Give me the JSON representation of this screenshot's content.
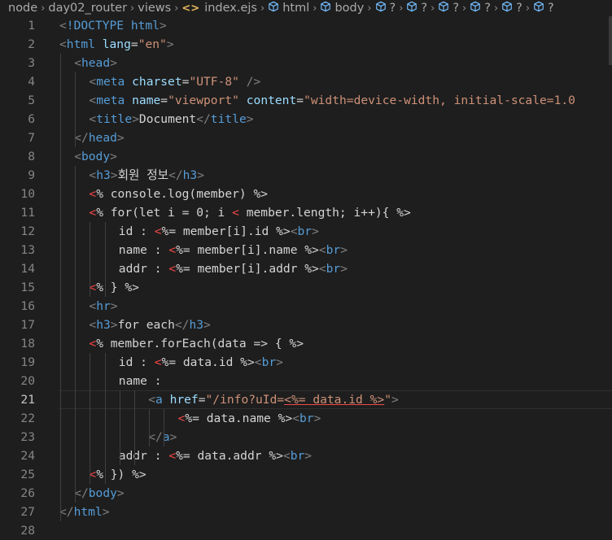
{
  "breadcrumb": {
    "items": [
      "node",
      "day02_router",
      "views",
      "index.ejs",
      "html",
      "body",
      "?",
      "?",
      "?",
      "?",
      "?",
      "?"
    ]
  },
  "editor": {
    "active_line": 21,
    "lines": [
      {
        "n": "1",
        "indent": 0,
        "tokens": [
          [
            "br",
            "<"
          ],
          [
            "tag",
            "!DOCTYPE "
          ],
          [
            "tag",
            "html"
          ],
          [
            "br",
            ">"
          ]
        ]
      },
      {
        "n": "2",
        "indent": 0,
        "tokens": [
          [
            "br",
            "<"
          ],
          [
            "tag",
            "html "
          ],
          [
            "attr",
            "lang"
          ],
          [
            "txt",
            "="
          ],
          [
            "str",
            "\"en\""
          ],
          [
            "br",
            ">"
          ]
        ]
      },
      {
        "n": "3",
        "indent": 1,
        "tokens": [
          [
            "br",
            "<"
          ],
          [
            "tag",
            "head"
          ],
          [
            "br",
            ">"
          ]
        ]
      },
      {
        "n": "4",
        "indent": 2,
        "tokens": [
          [
            "br",
            "<"
          ],
          [
            "tag",
            "meta "
          ],
          [
            "attr",
            "charset"
          ],
          [
            "txt",
            "="
          ],
          [
            "str",
            "\"UTF-8\""
          ],
          [
            "txt",
            " "
          ],
          [
            "br",
            "/>"
          ]
        ]
      },
      {
        "n": "5",
        "indent": 2,
        "tokens": [
          [
            "br",
            "<"
          ],
          [
            "tag",
            "meta "
          ],
          [
            "attr",
            "name"
          ],
          [
            "txt",
            "="
          ],
          [
            "str",
            "\"viewport\""
          ],
          [
            "txt",
            " "
          ],
          [
            "attr",
            "content"
          ],
          [
            "txt",
            "="
          ],
          [
            "str",
            "\"width=device-width, initial-scale=1.0"
          ]
        ]
      },
      {
        "n": "6",
        "indent": 2,
        "tokens": [
          [
            "br",
            "<"
          ],
          [
            "tag",
            "title"
          ],
          [
            "br",
            ">"
          ],
          [
            "txt",
            "Document"
          ],
          [
            "br",
            "</"
          ],
          [
            "tag",
            "title"
          ],
          [
            "br",
            ">"
          ]
        ]
      },
      {
        "n": "7",
        "indent": 1,
        "tokens": [
          [
            "br",
            "</"
          ],
          [
            "tag",
            "head"
          ],
          [
            "br",
            ">"
          ]
        ]
      },
      {
        "n": "8",
        "indent": 1,
        "tokens": [
          [
            "br",
            "<"
          ],
          [
            "tag",
            "body"
          ],
          [
            "br",
            ">"
          ]
        ]
      },
      {
        "n": "9",
        "indent": 2,
        "tokens": [
          [
            "br",
            "<"
          ],
          [
            "tag",
            "h3"
          ],
          [
            "br",
            ">"
          ],
          [
            "txt",
            "회원 정보"
          ],
          [
            "br",
            "</"
          ],
          [
            "tag",
            "h3"
          ],
          [
            "br",
            ">"
          ]
        ]
      },
      {
        "n": "10",
        "indent": 2,
        "tokens": [
          [
            "red",
            "<"
          ],
          [
            "ejs",
            "% console.log(member) %>"
          ]
        ]
      },
      {
        "n": "11",
        "indent": 2,
        "tokens": [
          [
            "red",
            "<"
          ],
          [
            "ejs",
            "% for(let i = 0; i "
          ],
          [
            "red",
            "<"
          ],
          [
            "ejs",
            " member.length; i++){ %>"
          ]
        ]
      },
      {
        "n": "12",
        "indent": 4,
        "tokens": [
          [
            "txt",
            "id : "
          ],
          [
            "red",
            "<"
          ],
          [
            "ejs",
            "%= member[i].id %>"
          ],
          [
            "br",
            "<"
          ],
          [
            "tag",
            "br"
          ],
          [
            "br",
            ">"
          ]
        ]
      },
      {
        "n": "13",
        "indent": 4,
        "tokens": [
          [
            "txt",
            "name : "
          ],
          [
            "red",
            "<"
          ],
          [
            "ejs",
            "%= member[i].name %>"
          ],
          [
            "br",
            "<"
          ],
          [
            "tag",
            "br"
          ],
          [
            "br",
            ">"
          ]
        ]
      },
      {
        "n": "14",
        "indent": 4,
        "tokens": [
          [
            "txt",
            "addr : "
          ],
          [
            "red",
            "<"
          ],
          [
            "ejs",
            "%= member[i].addr %>"
          ],
          [
            "br",
            "<"
          ],
          [
            "tag",
            "br"
          ],
          [
            "br",
            ">"
          ]
        ]
      },
      {
        "n": "15",
        "indent": 2,
        "tokens": [
          [
            "red",
            "<"
          ],
          [
            "ejs",
            "% } %>"
          ]
        ]
      },
      {
        "n": "16",
        "indent": 2,
        "tokens": [
          [
            "br",
            "<"
          ],
          [
            "tag",
            "hr"
          ],
          [
            "br",
            ">"
          ]
        ]
      },
      {
        "n": "17",
        "indent": 2,
        "tokens": [
          [
            "br",
            "<"
          ],
          [
            "tag",
            "h3"
          ],
          [
            "br",
            ">"
          ],
          [
            "txt",
            "for each"
          ],
          [
            "br",
            "</"
          ],
          [
            "tag",
            "h3"
          ],
          [
            "br",
            ">"
          ]
        ]
      },
      {
        "n": "18",
        "indent": 2,
        "tokens": [
          [
            "red",
            "<"
          ],
          [
            "ejs",
            "% member.forEach(data => { %>"
          ]
        ]
      },
      {
        "n": "19",
        "indent": 4,
        "tokens": [
          [
            "txt",
            "id : "
          ],
          [
            "red",
            "<"
          ],
          [
            "ejs",
            "%= data.id %>"
          ],
          [
            "br",
            "<"
          ],
          [
            "tag",
            "br"
          ],
          [
            "br",
            ">"
          ]
        ]
      },
      {
        "n": "20",
        "indent": 4,
        "tokens": [
          [
            "txt",
            "name :"
          ]
        ]
      },
      {
        "n": "21",
        "indent": 6,
        "tokens": [
          [
            "br",
            "<"
          ],
          [
            "tag",
            "a "
          ],
          [
            "attr",
            "href"
          ],
          [
            "txt",
            "="
          ],
          [
            "str",
            "\"/info?uId="
          ],
          [
            "sq",
            "<%= data.id %>"
          ],
          [
            "str",
            "\""
          ],
          [
            "br",
            ">"
          ]
        ]
      },
      {
        "n": "22",
        "indent": 8,
        "tokens": [
          [
            "red",
            "<"
          ],
          [
            "ejs",
            "%= data.name %>"
          ],
          [
            "br",
            "<"
          ],
          [
            "tag",
            "br"
          ],
          [
            "br",
            ">"
          ]
        ]
      },
      {
        "n": "23",
        "indent": 6,
        "tokens": [
          [
            "br",
            "</"
          ],
          [
            "tag",
            "a"
          ],
          [
            "br",
            ">"
          ]
        ]
      },
      {
        "n": "24",
        "indent": 4,
        "tokens": [
          [
            "txt",
            "addr : "
          ],
          [
            "red",
            "<"
          ],
          [
            "ejs",
            "%= data.addr %>"
          ],
          [
            "br",
            "<"
          ],
          [
            "tag",
            "br"
          ],
          [
            "br",
            ">"
          ]
        ]
      },
      {
        "n": "25",
        "indent": 2,
        "tokens": [
          [
            "red",
            "<"
          ],
          [
            "ejs",
            "% }) %>"
          ]
        ]
      },
      {
        "n": "26",
        "indent": 1,
        "tokens": [
          [
            "br",
            "</"
          ],
          [
            "tag",
            "body"
          ],
          [
            "br",
            ">"
          ]
        ]
      },
      {
        "n": "27",
        "indent": 0,
        "tokens": [
          [
            "br",
            "</"
          ],
          [
            "tag",
            "html"
          ],
          [
            "br",
            ">"
          ]
        ]
      },
      {
        "n": "28",
        "indent": 0,
        "tokens": []
      }
    ]
  },
  "colors": {
    "background": "#1e1e1e",
    "tag": "#569cd6",
    "bracket": "#808080",
    "attribute": "#9cdcfe",
    "string": "#ce9178",
    "text": "#d4d4d4",
    "error": "#f44747"
  }
}
